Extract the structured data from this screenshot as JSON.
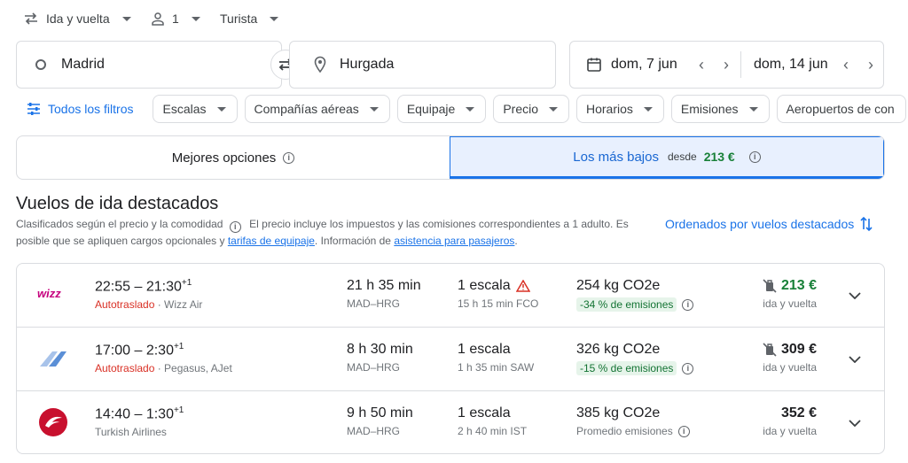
{
  "trip": {
    "type": "Ida y vuelta",
    "passengers": "1",
    "class": "Turista"
  },
  "search": {
    "origin": "Madrid",
    "destination": "Hurgada",
    "depart_date": "dom, 7 jun",
    "return_date": "dom, 14 jun"
  },
  "filters": {
    "all": "Todos los filtros",
    "chips": [
      "Escalas",
      "Compañías aéreas",
      "Equipaje",
      "Precio",
      "Horarios",
      "Emisiones",
      "Aeropuertos de con"
    ]
  },
  "tabs": {
    "best": "Mejores opciones",
    "cheapest": "Los más bajos",
    "from_label": "desde",
    "from_price": "213 €"
  },
  "section": {
    "title": "Vuelos de ida destacados",
    "desc_1": "Clasificados según el precio y la comodidad",
    "desc_2": "El precio incluye los impuestos y las comisiones correspondientes a 1 adulto. Es",
    "desc_3": "posible que se apliquen cargos opcionales y",
    "link_baggage": "tarifas de equipaje",
    "desc_4": ". Información de",
    "link_assist": "asistencia para pasajeros",
    "desc_5": ".",
    "sort": "Ordenados por vuelos destacados"
  },
  "flights": [
    {
      "times": "22:55 – 21:30",
      "plus": "+1",
      "self_transfer": "Autotraslado",
      "airline": " · Wizz Air",
      "duration": "21 h 35 min",
      "route": "MAD–HRG",
      "stops": "1 escala",
      "layover": "15 h 15 min FCO",
      "co2": "254 kg CO2e",
      "emissions": "-34 % de emisiones",
      "price": "213 €",
      "price_note": "ida y vuelta"
    },
    {
      "times": "17:00 – 2:30",
      "plus": "+1",
      "self_transfer": "Autotraslado",
      "airline": " · Pegasus, AJet",
      "duration": "8 h 30 min",
      "route": "MAD–HRG",
      "stops": "1 escala",
      "layover": "1 h 35 min SAW",
      "co2": "326 kg CO2e",
      "emissions": "-15 % de emisiones",
      "price": "309 €",
      "price_note": "ida y vuelta"
    },
    {
      "times": "14:40 – 1:30",
      "plus": "+1",
      "self_transfer": "",
      "airline": "Turkish Airlines",
      "duration": "9 h 50 min",
      "route": "MAD–HRG",
      "stops": "1 escala",
      "layover": "2 h 40 min IST",
      "co2": "385 kg CO2e",
      "emissions": "Promedio emisiones",
      "price": "352 €",
      "price_note": "ida y vuelta"
    }
  ],
  "colors": {
    "accent": "#1a73e8",
    "green": "#188038",
    "red": "#d93025"
  },
  "icons": {
    "trip_type": "swap-arrows-icon",
    "passengers": "person-icon",
    "origin": "circle-icon",
    "destination": "location-pin-icon",
    "swap": "swap-icon",
    "calendar": "calendar-icon",
    "filters": "sliders-icon",
    "sort": "sort-arrows-icon",
    "warning": "warning-triangle-icon",
    "no_bag": "no-carry-on-icon"
  }
}
